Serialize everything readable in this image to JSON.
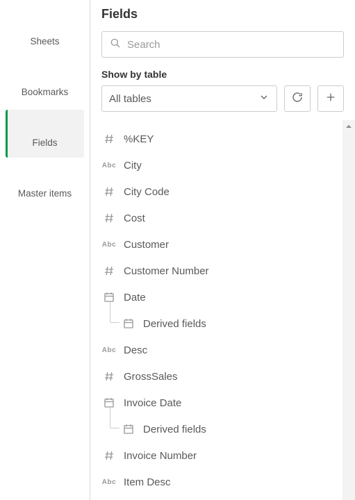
{
  "sidebar": {
    "items": [
      {
        "key": "sheets",
        "label": "Sheets"
      },
      {
        "key": "bookmarks",
        "label": "Bookmarks"
      },
      {
        "key": "fields",
        "label": "Fields"
      },
      {
        "key": "master",
        "label": "Master items"
      }
    ],
    "active": "fields"
  },
  "panel": {
    "title": "Fields",
    "search_placeholder": "Search",
    "showby_label": "Show by table",
    "table_select": {
      "selected": "All tables"
    }
  },
  "fields": [
    {
      "type": "hash",
      "label": "%KEY"
    },
    {
      "type": "abc",
      "label": "City"
    },
    {
      "type": "hash",
      "label": "City Code"
    },
    {
      "type": "hash",
      "label": "Cost"
    },
    {
      "type": "abc",
      "label": "Customer"
    },
    {
      "type": "hash",
      "label": "Customer Number"
    },
    {
      "type": "date",
      "label": "Date",
      "children": [
        {
          "type": "date",
          "label": "Derived fields"
        }
      ]
    },
    {
      "type": "abc",
      "label": "Desc"
    },
    {
      "type": "hash",
      "label": "GrossSales"
    },
    {
      "type": "date",
      "label": "Invoice Date",
      "children": [
        {
          "type": "date",
          "label": "Derived fields"
        }
      ]
    },
    {
      "type": "hash",
      "label": "Invoice Number"
    },
    {
      "type": "abc",
      "label": "Item Desc"
    }
  ]
}
